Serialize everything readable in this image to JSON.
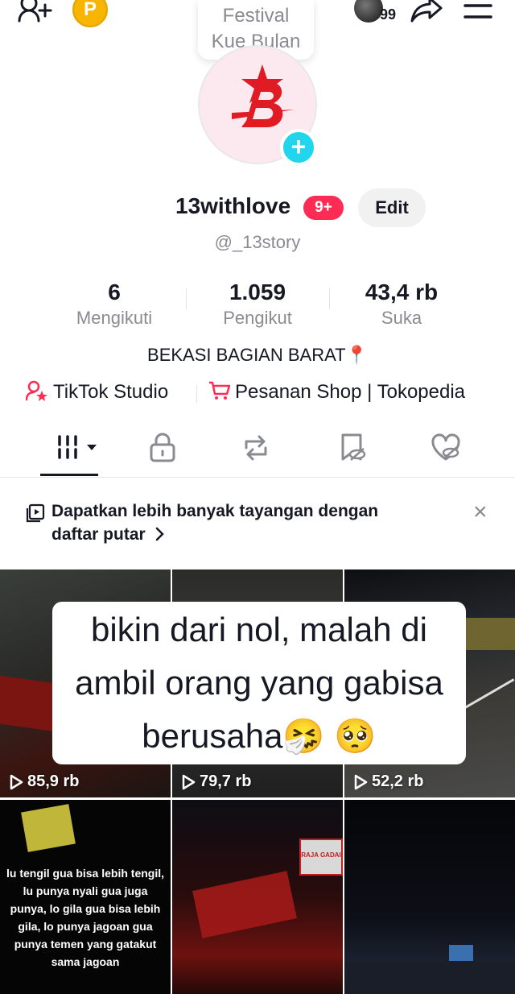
{
  "header": {
    "coin_label": "P",
    "bubble_text": [
      "Festival",
      "Kue Bulan"
    ],
    "story_count": "99"
  },
  "profile": {
    "display_name": "13withlove",
    "notification_badge": "9+",
    "edit_label": "Edit",
    "username": "@_13story",
    "bio": "BEKASI BAGIAN BARAT📍"
  },
  "stats": [
    {
      "value": "6",
      "label": "Mengikuti"
    },
    {
      "value": "1.059",
      "label": "Pengikut"
    },
    {
      "value": "43,4 rb",
      "label": "Suka"
    }
  ],
  "links": {
    "studio": "TikTok Studio",
    "shop": "Pesanan Shop | Tokopedia"
  },
  "tabs": [
    {
      "icon": "grid-icon",
      "active": true
    },
    {
      "icon": "lock-icon",
      "active": false
    },
    {
      "icon": "repost-icon",
      "active": false
    },
    {
      "icon": "bookmark-hidden-icon",
      "active": false
    },
    {
      "icon": "liked-hidden-icon",
      "active": false
    }
  ],
  "banner": {
    "text": "Dapatkan lebih banyak tayangan dengan daftar putar",
    "close": "×"
  },
  "overlay": {
    "line1": "bikin dari nol, malah di",
    "line2": "ambil orang yang gabisa",
    "line3": "berusaha🤧 🥺"
  },
  "videos": [
    {
      "views": "85,9 rb"
    },
    {
      "views": "79,7 rb"
    },
    {
      "views": "52,2 rb"
    },
    {
      "views": "",
      "caption": "lu tengil gua bisa lebih tengil, lu punya nyali gua juga punya, lo gila gua bisa lebih gila, lo punya jagoan gua punya temen yang gatakut sama jagoan"
    },
    {
      "views": "",
      "sign": "RAJA GADAI"
    },
    {
      "views": ""
    }
  ],
  "colors": {
    "accent": "#fe2c55",
    "plus": "#20d5ec",
    "coin": "#f7b500",
    "text": "#161823",
    "muted": "#8a8b91"
  }
}
